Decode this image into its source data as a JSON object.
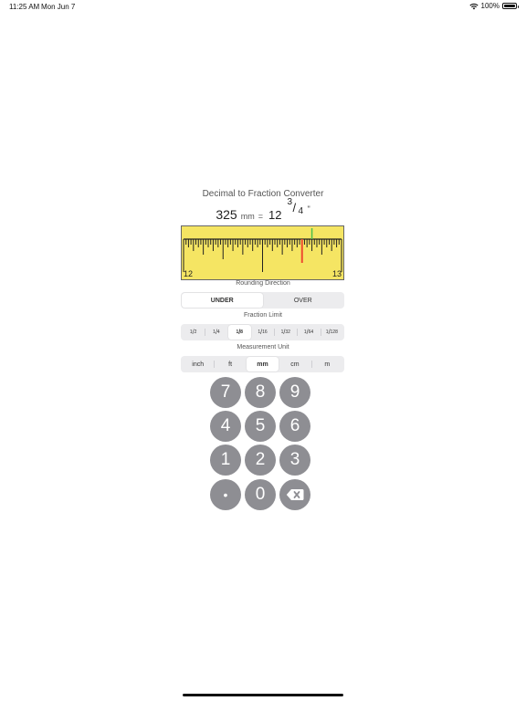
{
  "status_bar": {
    "time": "11:25 AM",
    "date": "Mon Jun 7",
    "battery": "100%",
    "battery_level": 1.0
  },
  "title": "Decimal to Fraction Converter",
  "result": {
    "value": "325",
    "unit": "mm",
    "equals": "=",
    "whole": "12",
    "numerator": "3",
    "slash": "/",
    "denominator": "4",
    "inch_mark": "\""
  },
  "ruler": {
    "start_label": "12",
    "end_label": "13",
    "background": "#f5e563",
    "marker_color": "#ee4a2f",
    "highlight_color": "#4cbf4c",
    "marker_value": 0.75,
    "highlight_value": 0.8125
  },
  "rounding": {
    "label": "Rounding Direction",
    "options": [
      "UNDER",
      "OVER"
    ],
    "selected": "UNDER"
  },
  "fraction_limit": {
    "label": "Fraction Limit",
    "options": [
      {
        "num": "1",
        "den": "2"
      },
      {
        "num": "1",
        "den": "4"
      },
      {
        "num": "1",
        "den": "8"
      },
      {
        "num": "1",
        "den": "16"
      },
      {
        "num": "1",
        "den": "32"
      },
      {
        "num": "1",
        "den": "64"
      },
      {
        "num": "1",
        "den": "128"
      }
    ],
    "selected_index": 2
  },
  "measurement_unit": {
    "label": "Measurement Unit",
    "options": [
      "inch",
      "ft",
      "mm",
      "cm",
      "m"
    ],
    "selected": "mm"
  },
  "keypad": {
    "keys": [
      "7",
      "8",
      "9",
      "4",
      "5",
      "6",
      "1",
      "2",
      "3",
      "•",
      "0",
      "backspace-icon"
    ],
    "key_color": "#8e8e93"
  }
}
